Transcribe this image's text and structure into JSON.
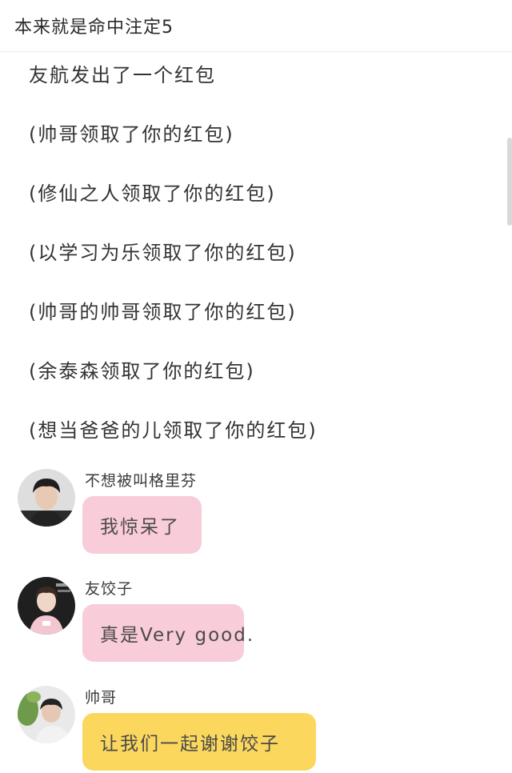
{
  "header": {
    "title": "本来就是命中注定5"
  },
  "notices": [
    "友航发出了一个红包",
    "(帅哥领取了你的红包)",
    "(修仙之人领取了你的红包)",
    "(以学习为乐领取了你的红包)",
    "(帅哥的帅哥领取了你的红包)",
    "(余泰森领取了你的红包)",
    "(想当爸爸的儿领取了你的红包)"
  ],
  "messages": [
    {
      "sender": "不想被叫格里芬",
      "text": "我惊呆了",
      "bubble_color": "#f9ccd9"
    },
    {
      "sender": "友饺子",
      "text": "真是Very good.",
      "bubble_color": "#f9ccd9"
    },
    {
      "sender": "帅哥",
      "text": "让我们一起谢谢饺子",
      "bubble_color": "#fbd85d"
    }
  ],
  "colors": {
    "pink_bubble": "#f9ccd9",
    "yellow_bubble": "#fbd85d",
    "text": "#333333"
  }
}
